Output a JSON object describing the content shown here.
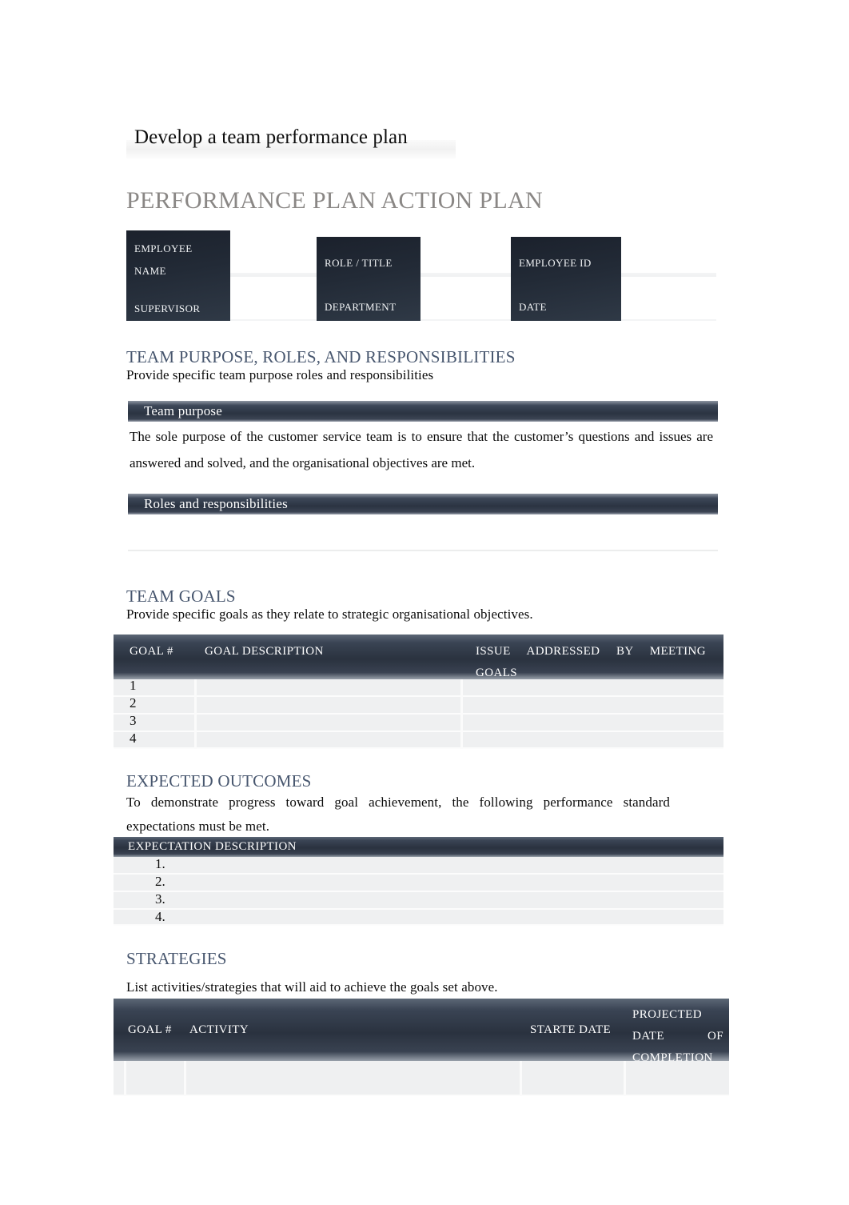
{
  "document": {
    "header_title": "Develop a team performance plan",
    "main_title": "PERFORMANCE PLAN ACTION PLAN"
  },
  "employee_info": {
    "labels": {
      "employee_name_line1": "EMPLOYEE",
      "employee_name_line2": "NAME",
      "role_title": "ROLE / TITLE",
      "employee_id": "EMPLOYEE ID",
      "supervisor": "SUPERVISOR",
      "department": "DEPARTMENT",
      "date": "DATE"
    },
    "values": {
      "employee_name": "",
      "role_title": "",
      "employee_id": "",
      "supervisor": "",
      "department": "",
      "date": ""
    }
  },
  "team_purpose_section": {
    "heading": "TEAM PURPOSE, ROLES, AND RESPONSIBILITIES",
    "subtitle": "Provide specific team purpose roles and responsibilities",
    "purpose_label": "Team purpose",
    "purpose_text": "The sole purpose of the customer service team is to ensure that the customer’s questions and issues are answered and solved, and the organisational objectives are met.",
    "roles_label": "Roles and responsibilities",
    "roles_text": ""
  },
  "team_goals_section": {
    "heading": "TEAM GOALS",
    "subtitle": "Provide specific goals as they relate to strategic organisational objectives.",
    "columns": [
      "GOAL #",
      "GOAL DESCRIPTION",
      "ISSUE ADDRESSED BY MEETING GOALS"
    ],
    "rows": [
      {
        "goal_no": "1",
        "description": "",
        "issue": ""
      },
      {
        "goal_no": "2",
        "description": "",
        "issue": ""
      },
      {
        "goal_no": "3",
        "description": "",
        "issue": ""
      },
      {
        "goal_no": "4",
        "description": "",
        "issue": ""
      }
    ]
  },
  "expected_outcomes_section": {
    "heading": "EXPECTED OUTCOMES",
    "subtitle": "To demonstrate progress toward goal achievement, the following performance standard expectations must be met.",
    "column": "EXPECTATION DESCRIPTION",
    "rows": [
      {
        "marker": "1.",
        "text": ""
      },
      {
        "marker": "2.",
        "text": ""
      },
      {
        "marker": "3.",
        "text": ""
      },
      {
        "marker": "4.",
        "text": ""
      }
    ]
  },
  "strategies_section": {
    "heading": "STRATEGIES",
    "subtitle": "List activities/strategies that will aid to achieve the goals set above.",
    "columns": [
      "GOAL #",
      "ACTIVITY",
      "STARTE DATE",
      "PROJECTED DATE OF COMPLETION"
    ],
    "rows": [
      {
        "goal_no": "",
        "activity": "",
        "start_date": "",
        "projected_date": ""
      }
    ]
  },
  "colors": {
    "heading": "#47566e",
    "main_title": "#8a8785",
    "dark_cell": "#222a36",
    "bar_dark": "#2b3442",
    "row_fill": "#eff0f1"
  }
}
